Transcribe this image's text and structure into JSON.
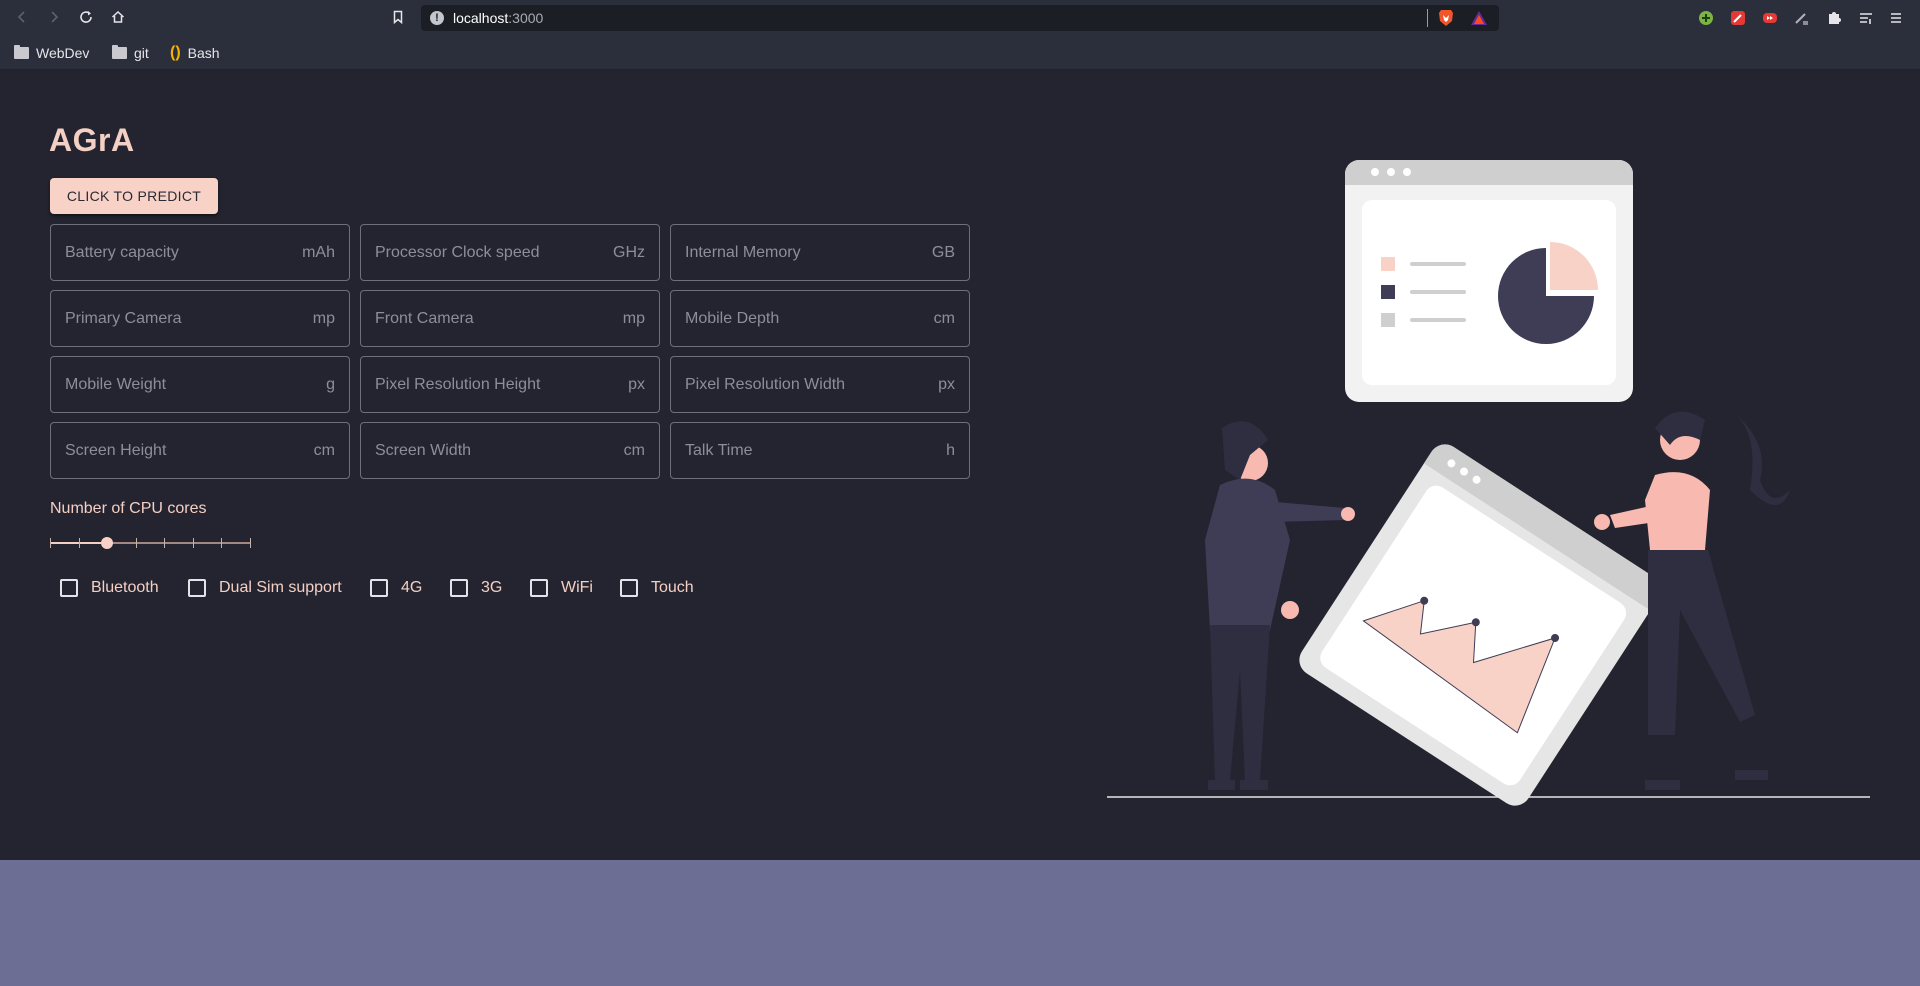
{
  "browser": {
    "url_host": "localhost",
    "url_port": ":3000",
    "bookmarks": [
      {
        "label": "WebDev",
        "icon": "folder-icon"
      },
      {
        "label": "git",
        "icon": "folder-icon"
      },
      {
        "label": "Bash",
        "icon": "bash-icon"
      }
    ]
  },
  "app": {
    "title": "AGrA",
    "predict_button": "CLICK TO PREDICT",
    "fields": [
      {
        "placeholder": "Battery capacity",
        "unit": "mAh"
      },
      {
        "placeholder": "Processor Clock speed",
        "unit": "GHz"
      },
      {
        "placeholder": "Internal Memory",
        "unit": "GB"
      },
      {
        "placeholder": "Primary Camera",
        "unit": "mp"
      },
      {
        "placeholder": "Front Camera",
        "unit": "mp"
      },
      {
        "placeholder": "Mobile Depth",
        "unit": "cm"
      },
      {
        "placeholder": "Mobile Weight",
        "unit": "g"
      },
      {
        "placeholder": "Pixel Resolution Height",
        "unit": "px"
      },
      {
        "placeholder": "Pixel Resolution Width",
        "unit": "px"
      },
      {
        "placeholder": "Screen Height",
        "unit": "cm"
      },
      {
        "placeholder": "Screen Width",
        "unit": "cm"
      },
      {
        "placeholder": "Talk Time",
        "unit": "h"
      }
    ],
    "cpu_cores": {
      "label": "Number of CPU cores",
      "min": 1,
      "max": 8,
      "step": 1,
      "value": 3
    },
    "checkboxes": [
      {
        "label": "Bluetooth",
        "checked": false
      },
      {
        "label": "Dual Sim support",
        "checked": false
      },
      {
        "label": "4G",
        "checked": false
      },
      {
        "label": "3G",
        "checked": false
      },
      {
        "label": "WiFi",
        "checked": false
      },
      {
        "label": "Touch",
        "checked": false
      }
    ]
  },
  "colors": {
    "page_bg": "#23242f",
    "accent": "#f8d2c7",
    "footer_bg": "#6c6f93",
    "chrome_bg": "#2b2e3b"
  }
}
